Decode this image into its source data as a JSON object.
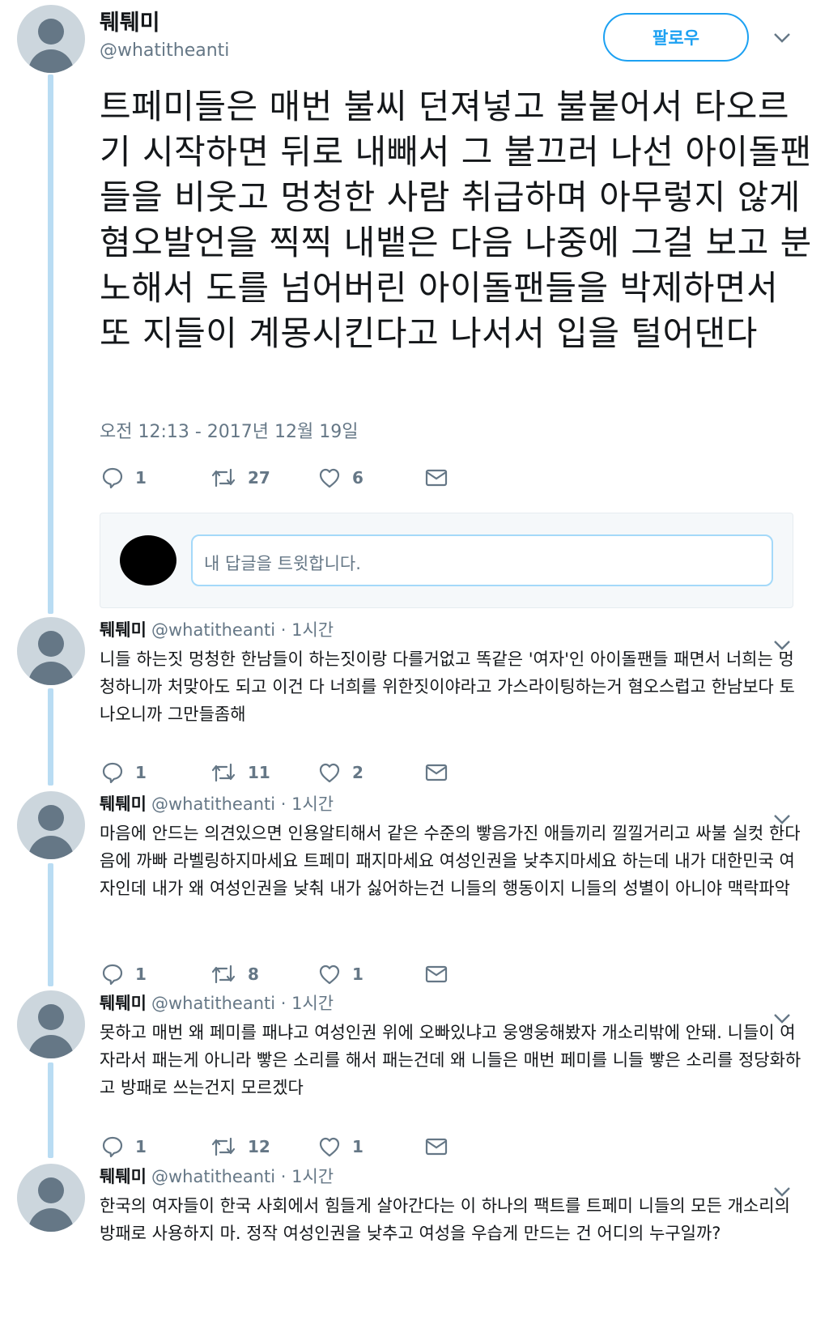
{
  "main": {
    "name": "퉤퉤미",
    "handle": "@whatitheanti",
    "follow_label": "팔로우",
    "text": "트페미들은 매번 불씨 던져넣고 불붙어서 타오르기 시작하면 뒤로 내빼서 그 불끄러 나선 아이돌팬들을 비웃고 멍청한 사람 취급하며 아무렇지 않게 혐오발언을 찍찍 내뱉은 다음 나중에 그걸 보고 분노해서 도를 넘어버린 아이돌팬들을 박제하면서 또 지들이 계몽시킨다고 나서서 입을 털어댄다",
    "timestamp": "오전 12:13 - 2017년 12월 19일",
    "replies": "1",
    "retweets": "27",
    "likes": "6"
  },
  "reply_box": {
    "placeholder": "내 답글을 트윗합니다."
  },
  "replies": [
    {
      "name": "퉤퉤미",
      "meta": "@whatitheanti · 1시간",
      "text": "니들 하는짓 멍청한 한남들이 하는짓이랑 다를거없고 똑같은 '여자'인 아이돌팬들 패면서 너희는 멍청하니까 처맞아도 되고 이건 다 너희를 위한짓이야라고 가스라이팅하는거 혐오스럽고 한남보다 토나오니까 그만들좀해",
      "replies": "1",
      "retweets": "11",
      "likes": "2"
    },
    {
      "name": "퉤퉤미",
      "meta": "@whatitheanti · 1시간",
      "text": "마음에 안드는 의견있으면 인용알티해서 같은 수준의 빻음가진 애들끼리 낄낄거리고 싸불 실컷 한다음에 까빠 라벨링하지마세요 트페미 패지마세요 여성인권을 낮추지마세요 하는데 내가 대한민국 여자인데 내가 왜 여성인권을 낮춰 내가 싫어하는건 니들의 행동이지 니들의 성별이 아니야 맥락파악",
      "replies": "1",
      "retweets": "8",
      "likes": "1"
    },
    {
      "name": "퉤퉤미",
      "meta": "@whatitheanti · 1시간",
      "text": "못하고 매번 왜 페미를 패냐고 여성인권 위에 오빠있냐고 웅앵웅해봤자 개소리밖에 안돼. 니들이 여자라서 패는게 아니라 빻은 소리를 해서 패는건데 왜 니들은 매번 페미를 니들 빻은 소리를 정당화하고 방패로 쓰는건지 모르겠다",
      "replies": "1",
      "retweets": "12",
      "likes": "1"
    },
    {
      "name": "퉤퉤미",
      "meta": "@whatitheanti · 1시간",
      "text": "한국의 여자들이 한국 사회에서 힘들게 살아간다는 이 하나의 팩트를 트페미 니들의 모든 개소리의 방패로 사용하지 마. 정작 여성인권을 낮추고 여성을 우습게 만드는 건 어디의 누구일까?"
    }
  ],
  "colors": {
    "accent": "#1da1f2",
    "thread_line": "#b9dcf3",
    "muted": "#657786"
  },
  "icons": [
    "reply-icon",
    "retweet-icon",
    "like-icon",
    "dm-icon",
    "chevron-down-icon"
  ]
}
